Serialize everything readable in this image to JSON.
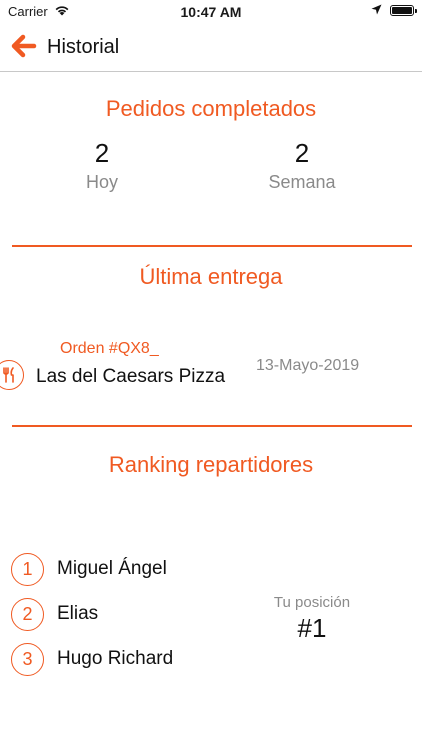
{
  "status_bar": {
    "carrier": "Carrier",
    "time": "10:47 AM"
  },
  "nav": {
    "title": "Historial",
    "back_icon": "arrow-left-icon"
  },
  "colors": {
    "accent": "#f05a22",
    "muted": "#8a8a8a",
    "text": "#111111"
  },
  "completed_orders": {
    "title": "Pedidos completados",
    "today": {
      "value": "2",
      "label": "Hoy"
    },
    "week": {
      "value": "2",
      "label": "Semana"
    }
  },
  "last_delivery": {
    "title": "Última entrega",
    "order_id": "Orden #QX8_",
    "restaurant": "Las del Caesars Pizza",
    "date": "13-Mayo-2019",
    "icon": "restaurant-icon"
  },
  "ranking": {
    "title": "Ranking repartidores",
    "items": [
      {
        "rank": "1",
        "name": "Miguel Ángel"
      },
      {
        "rank": "2",
        "name": "Elias"
      },
      {
        "rank": "3",
        "name": "Hugo Richard"
      }
    ],
    "position_label": "Tu posición",
    "position_value": "#1"
  }
}
